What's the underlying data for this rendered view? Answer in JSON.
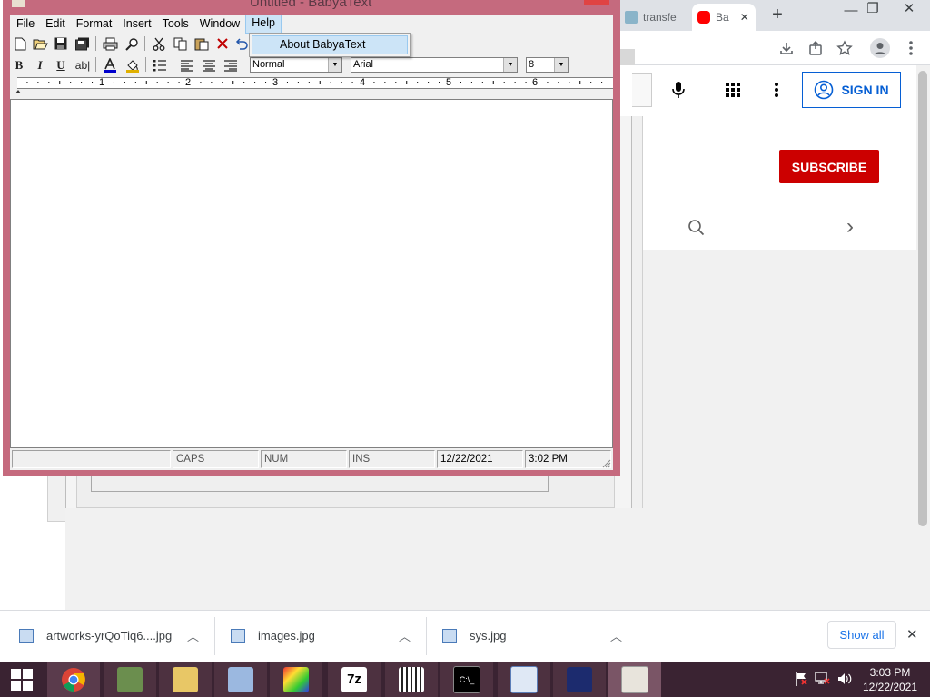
{
  "browser": {
    "tabs": [
      {
        "label": "transfe",
        "favicon": "upload-icon"
      },
      {
        "label": "Ba",
        "favicon": "youtube-icon"
      }
    ],
    "new_tab_symbol": "+",
    "tab_close_symbol": "✕",
    "window_controls": {
      "minimize": "—",
      "restore": "❐",
      "close": "✕"
    },
    "youtube": {
      "sign_in_label": "SIGN IN",
      "subscribe_label": "SUBSCRIBE",
      "chevron_symbol": "›"
    }
  },
  "app": {
    "title": "Untitled - BabyaText",
    "menu": [
      "File",
      "Edit",
      "Format",
      "Insert",
      "Tools",
      "Window",
      "Help"
    ],
    "open_menu": "Help",
    "help_menu_items": [
      "About BabyaText"
    ],
    "format_bar": {
      "bold": "B",
      "italic": "I",
      "underline": "U",
      "strike": "ab|",
      "style_value": "Normal",
      "font_value": "Arial",
      "size_value": "8"
    },
    "ruler_numbers": [
      "1",
      "2",
      "3",
      "4",
      "5",
      "6"
    ],
    "status": {
      "caps": "CAPS",
      "num": "NUM",
      "ins": "INS",
      "date": "12/22/2021",
      "time": "3:02 PM"
    }
  },
  "downloads": {
    "items": [
      "artworks-yrQoTiq6....jpg",
      "images.jpg",
      "sys.jpg"
    ],
    "show_all_label": "Show all",
    "close_symbol": "✕"
  },
  "taskbar": {
    "apps": [
      "start",
      "chrome",
      "tree-app",
      "folder-mail",
      "paint-brush",
      "paint-app",
      "7z",
      "piano",
      "terminal",
      "document-app",
      "suite-app",
      "babyatext"
    ],
    "sevenzip_label": "7z",
    "terminal_label": "C:\\_",
    "clock_time": "3:03 PM",
    "clock_date": "12/22/2021"
  },
  "colors": {
    "window_frame": "#c56a7e",
    "taskbar": "#3a2332",
    "youtube_red": "#cc0000",
    "link_blue": "#065fd4"
  }
}
